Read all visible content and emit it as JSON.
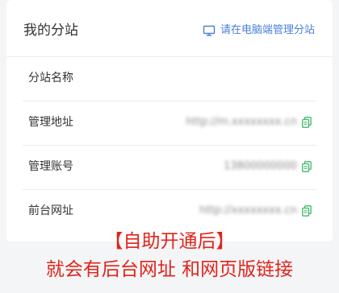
{
  "card": {
    "title": "我的分站",
    "manage_link": "请在电脑端管理分站"
  },
  "rows": [
    {
      "label": "分站名称",
      "value": ""
    },
    {
      "label": "管理地址",
      "value": "http://m.xxxxxxxx.cn"
    },
    {
      "label": "管理账号",
      "value": "13800000000"
    },
    {
      "label": "前台网址",
      "value": "http://xxxxxxxx.cn"
    }
  ],
  "caption": {
    "line1": "【自助开通后】",
    "line2": "就会有后台网址 和网页版链接"
  },
  "colors": {
    "accent": "#4a7fd9",
    "copy_icon": "#3fb86a",
    "caption": "#e0241a"
  },
  "icons": {
    "manage": "monitor-icon",
    "copy": "copy-icon"
  }
}
